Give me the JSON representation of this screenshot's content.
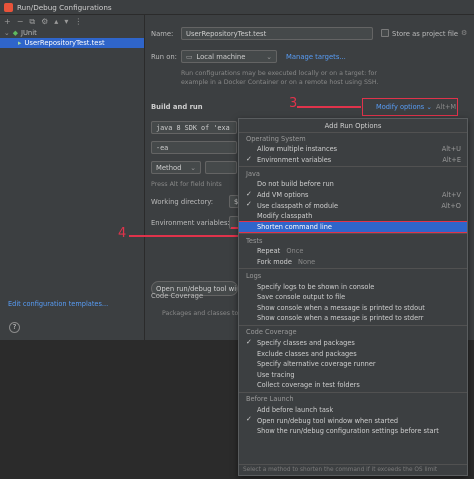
{
  "window": {
    "title": "Run/Debug Configurations"
  },
  "toolbar": {
    "icons": [
      "+",
      "−",
      "⧉",
      "⚙",
      "▴",
      "▾",
      "⋮"
    ]
  },
  "tree": {
    "group_label": "JUnit",
    "item_label": "UserRepositoryTest.test"
  },
  "sidebar": {
    "edit_templates": "Edit configuration templates..."
  },
  "help": {
    "label": "?"
  },
  "form": {
    "name_label": "Name:",
    "name_value": "UserRepositoryTest.test",
    "store_label": "Store as project file",
    "run_on_label": "Run on:",
    "run_on_value": "Local machine",
    "manage_targets": "Manage targets...",
    "hint_lines": [
      "Run configurations may be executed locally or on a target: for",
      "example in a Docker Container or on a remote host using SSH."
    ],
    "build_and_run": "Build and run",
    "modify_options_label": "Modify options",
    "modify_options_shortcut": "Alt+M",
    "jdk_value": "java 8  SDK of 'exa",
    "vm_value": "-ea",
    "method_value": "Method",
    "field_hint": "Press Alt for field hints",
    "working_dir_label": "Working directory:",
    "working_dir_value": "$",
    "env_vars_label": "Environment variables:",
    "open_tool_window": "Open run/debug tool win",
    "code_coverage_label": "Code Coverage",
    "code_coverage_hint": "Packages and classes to"
  },
  "annotations": {
    "marker3": "3",
    "marker4": "4"
  },
  "popup": {
    "title": "Add Run Options",
    "sections": [
      {
        "title": "Operating System",
        "items": [
          {
            "label": "Allow multiple instances",
            "shortcut": "Alt+U",
            "checked": false
          },
          {
            "label": "Environment variables",
            "shortcut": "Alt+E",
            "checked": true
          }
        ]
      },
      {
        "title": "Java",
        "items": [
          {
            "label": "Do not build before run",
            "shortcut": "",
            "checked": false
          },
          {
            "label": "Add VM options",
            "shortcut": "Alt+V",
            "checked": true
          },
          {
            "label": "Use classpath of module",
            "shortcut": "Alt+O",
            "checked": true
          },
          {
            "label": "Modify classpath",
            "shortcut": "",
            "checked": false
          },
          {
            "label": "Shorten command line",
            "shortcut": "",
            "checked": false,
            "highlighted": true
          }
        ]
      },
      {
        "title": "Tests",
        "items": [
          {
            "label": "Repeat",
            "value": "Once",
            "shortcut": "",
            "checked": false
          },
          {
            "label": "Fork mode",
            "value": "None",
            "shortcut": "",
            "checked": false
          }
        ]
      },
      {
        "title": "Logs",
        "items": [
          {
            "label": "Specify logs to be shown in console",
            "shortcut": "",
            "checked": false
          },
          {
            "label": "Save console output to file",
            "shortcut": "",
            "checked": false
          },
          {
            "label": "Show console when a message is printed to stdout",
            "shortcut": "",
            "checked": false
          },
          {
            "label": "Show console when a message is printed to stderr",
            "shortcut": "",
            "checked": false
          }
        ]
      },
      {
        "title": "Code Coverage",
        "items": [
          {
            "label": "Specify classes and packages",
            "shortcut": "",
            "checked": true
          },
          {
            "label": "Exclude classes and packages",
            "shortcut": "",
            "checked": false
          },
          {
            "label": "Specify alternative coverage runner",
            "shortcut": "",
            "checked": false
          },
          {
            "label": "Use tracing",
            "shortcut": "",
            "checked": false
          },
          {
            "label": "Collect coverage in test folders",
            "shortcut": "",
            "checked": false
          }
        ]
      },
      {
        "title": "Before Launch",
        "items": [
          {
            "label": "Add before launch task",
            "shortcut": "",
            "checked": false
          },
          {
            "label": "Open run/debug tool window when started",
            "shortcut": "",
            "checked": true
          },
          {
            "label": "Show the run/debug configuration settings before start",
            "shortcut": "",
            "checked": false
          }
        ]
      }
    ],
    "status": "Select a method to shorten the command if it exceeds the OS limit"
  },
  "colors": {
    "accent": "#2f65ca",
    "annotation": "#e0334b",
    "link": "#589df6"
  }
}
